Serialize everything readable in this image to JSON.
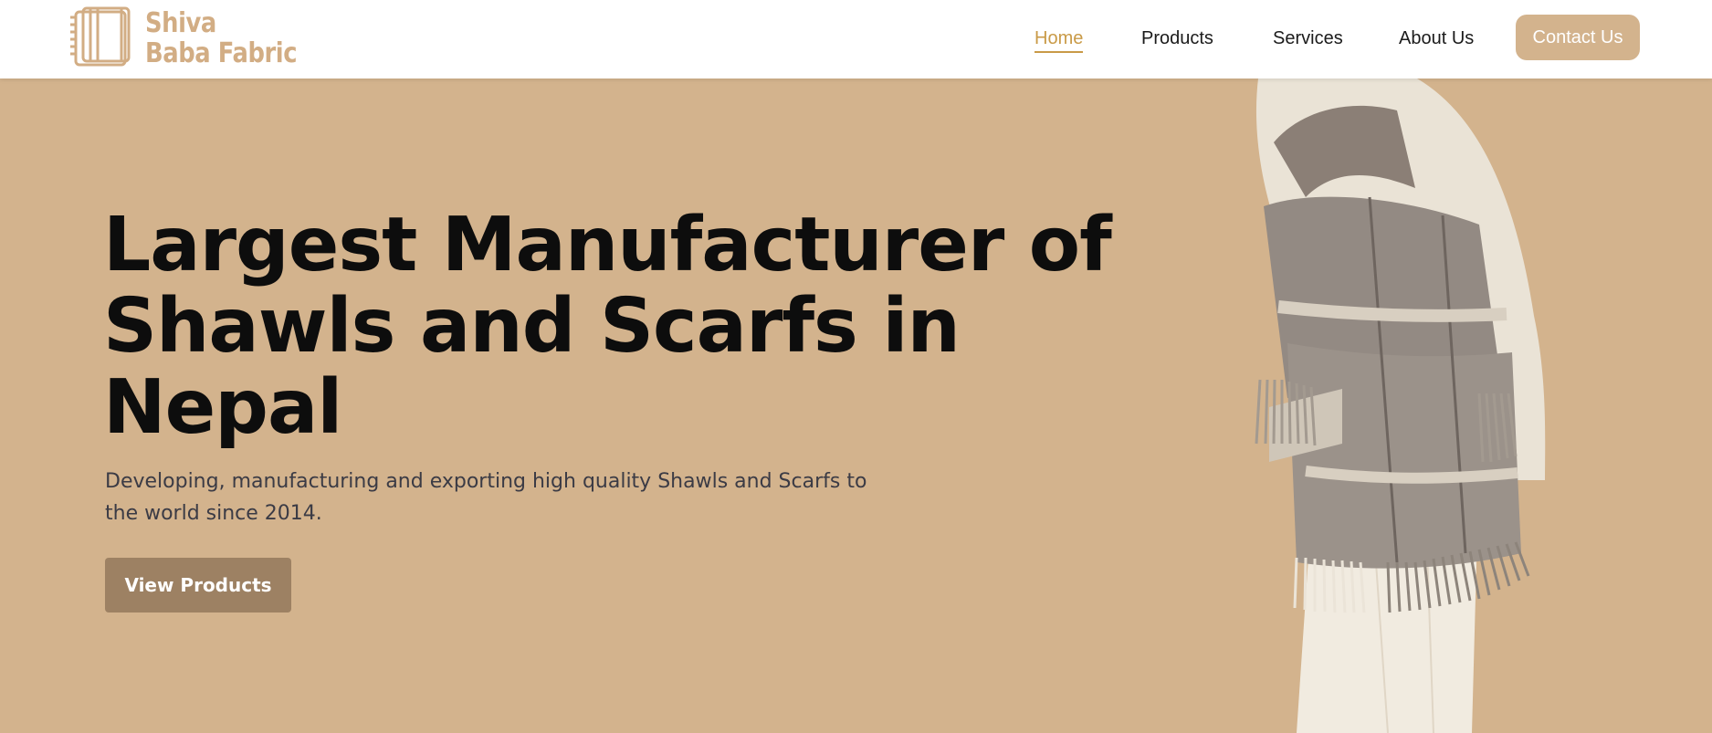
{
  "brand": {
    "line1": "Shiva",
    "line2": "Baba Fabric",
    "color": "#d2ad84",
    "icon": "folded-fabric-icon"
  },
  "nav": {
    "items": [
      {
        "label": "Home",
        "active": true
      },
      {
        "label": "Products",
        "active": false
      },
      {
        "label": "Services",
        "active": false
      },
      {
        "label": "About Us",
        "active": false
      }
    ],
    "contact_label": "Contact Us",
    "active_color": "#c99a47"
  },
  "hero": {
    "title": "Largest Manufacturer of Shawls and Scarfs in Nepal",
    "subtitle": "Developing, manufacturing and exporting high quality Shawls and Scarfs to the world since 2014.",
    "cta_label": "View Products",
    "background": "#d3b38d",
    "cta_color": "#9d8163"
  },
  "image": {
    "subject": "person-wrapped-in-grey-plaid-shawl-with-fringes"
  }
}
